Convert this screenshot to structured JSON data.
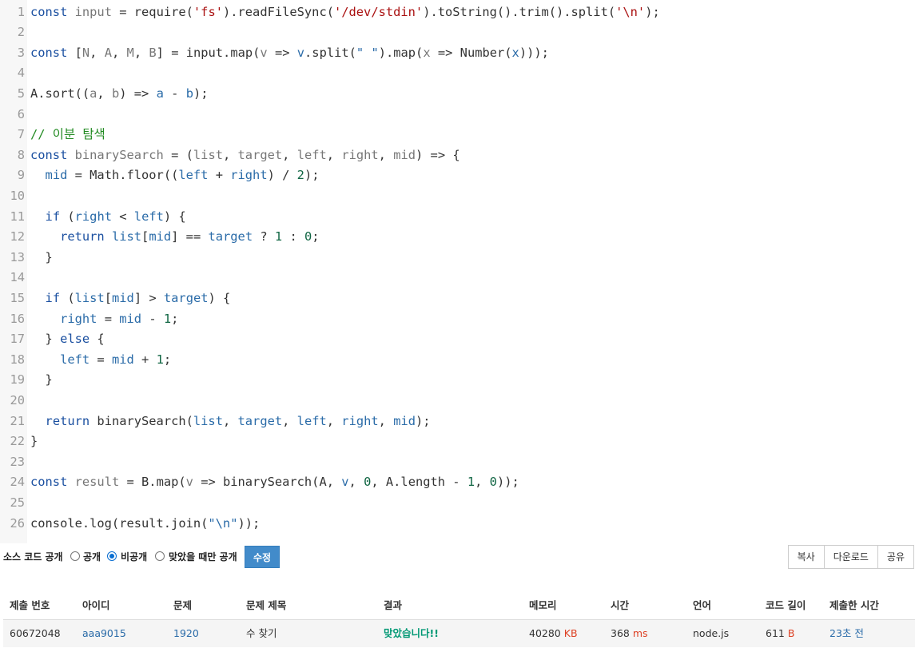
{
  "code": {
    "lines": [
      {
        "n": "1",
        "tokens": [
          [
            "kw",
            "const"
          ],
          [
            "p",
            " "
          ],
          [
            "def",
            "input"
          ],
          [
            "p",
            " = require("
          ],
          [
            "str",
            "'fs'"
          ],
          [
            "p",
            ").readFileSync("
          ],
          [
            "str",
            "'/dev/stdin'"
          ],
          [
            "p",
            ").toString().trim().split("
          ],
          [
            "str",
            "'\\n'"
          ],
          [
            "p",
            ");"
          ]
        ]
      },
      {
        "n": "2",
        "tokens": []
      },
      {
        "n": "3",
        "tokens": [
          [
            "kw",
            "const"
          ],
          [
            "p",
            " ["
          ],
          [
            "def",
            "N"
          ],
          [
            "p",
            ", "
          ],
          [
            "def",
            "A"
          ],
          [
            "p",
            ", "
          ],
          [
            "def",
            "M"
          ],
          [
            "p",
            ", "
          ],
          [
            "def",
            "B"
          ],
          [
            "p",
            "] = input.map("
          ],
          [
            "def",
            "v"
          ],
          [
            "p",
            " => "
          ],
          [
            "var",
            "v"
          ],
          [
            "p",
            ".split("
          ],
          [
            "str2",
            "\" \""
          ],
          [
            "p",
            ").map("
          ],
          [
            "def",
            "x"
          ],
          [
            "p",
            " => Number("
          ],
          [
            "var",
            "x"
          ],
          [
            "p",
            ")));"
          ]
        ]
      },
      {
        "n": "4",
        "tokens": []
      },
      {
        "n": "5",
        "tokens": [
          [
            "p",
            "A.sort(("
          ],
          [
            "def",
            "a"
          ],
          [
            "p",
            ", "
          ],
          [
            "def",
            "b"
          ],
          [
            "p",
            ") => "
          ],
          [
            "var",
            "a"
          ],
          [
            "p",
            " - "
          ],
          [
            "var",
            "b"
          ],
          [
            "p",
            ");"
          ]
        ]
      },
      {
        "n": "6",
        "tokens": []
      },
      {
        "n": "7",
        "tokens": [
          [
            "com",
            "// 이분 탐색"
          ]
        ]
      },
      {
        "n": "8",
        "tokens": [
          [
            "kw",
            "const"
          ],
          [
            "p",
            " "
          ],
          [
            "def",
            "binarySearch"
          ],
          [
            "p",
            " = ("
          ],
          [
            "def",
            "list"
          ],
          [
            "p",
            ", "
          ],
          [
            "def",
            "target"
          ],
          [
            "p",
            ", "
          ],
          [
            "def",
            "left"
          ],
          [
            "p",
            ", "
          ],
          [
            "def",
            "right"
          ],
          [
            "p",
            ", "
          ],
          [
            "def",
            "mid"
          ],
          [
            "p",
            ") => {"
          ]
        ]
      },
      {
        "n": "9",
        "tokens": [
          [
            "p",
            "  "
          ],
          [
            "var",
            "mid"
          ],
          [
            "p",
            " = Math.floor(("
          ],
          [
            "var",
            "left"
          ],
          [
            "p",
            " + "
          ],
          [
            "var",
            "right"
          ],
          [
            "p",
            ") / "
          ],
          [
            "num",
            "2"
          ],
          [
            "p",
            ");"
          ]
        ]
      },
      {
        "n": "10",
        "tokens": []
      },
      {
        "n": "11",
        "tokens": [
          [
            "p",
            "  "
          ],
          [
            "kw",
            "if"
          ],
          [
            "p",
            " ("
          ],
          [
            "var",
            "right"
          ],
          [
            "p",
            " < "
          ],
          [
            "var",
            "left"
          ],
          [
            "p",
            ") {"
          ]
        ]
      },
      {
        "n": "12",
        "tokens": [
          [
            "p",
            "    "
          ],
          [
            "kw",
            "return"
          ],
          [
            "p",
            " "
          ],
          [
            "var",
            "list"
          ],
          [
            "p",
            "["
          ],
          [
            "var",
            "mid"
          ],
          [
            "p",
            "] == "
          ],
          [
            "var",
            "target"
          ],
          [
            "p",
            " ? "
          ],
          [
            "num",
            "1"
          ],
          [
            "p",
            " : "
          ],
          [
            "num",
            "0"
          ],
          [
            "p",
            ";"
          ]
        ]
      },
      {
        "n": "13",
        "tokens": [
          [
            "p",
            "  }"
          ]
        ]
      },
      {
        "n": "14",
        "tokens": []
      },
      {
        "n": "15",
        "tokens": [
          [
            "p",
            "  "
          ],
          [
            "kw",
            "if"
          ],
          [
            "p",
            " ("
          ],
          [
            "var",
            "list"
          ],
          [
            "p",
            "["
          ],
          [
            "var",
            "mid"
          ],
          [
            "p",
            "] > "
          ],
          [
            "var",
            "target"
          ],
          [
            "p",
            ") {"
          ]
        ]
      },
      {
        "n": "16",
        "tokens": [
          [
            "p",
            "    "
          ],
          [
            "var",
            "right"
          ],
          [
            "p",
            " = "
          ],
          [
            "var",
            "mid"
          ],
          [
            "p",
            " - "
          ],
          [
            "num",
            "1"
          ],
          [
            "p",
            ";"
          ]
        ]
      },
      {
        "n": "17",
        "tokens": [
          [
            "p",
            "  } "
          ],
          [
            "kw",
            "else"
          ],
          [
            "p",
            " {"
          ]
        ]
      },
      {
        "n": "18",
        "tokens": [
          [
            "p",
            "    "
          ],
          [
            "var",
            "left"
          ],
          [
            "p",
            " = "
          ],
          [
            "var",
            "mid"
          ],
          [
            "p",
            " + "
          ],
          [
            "num",
            "1"
          ],
          [
            "p",
            ";"
          ]
        ]
      },
      {
        "n": "19",
        "tokens": [
          [
            "p",
            "  }"
          ]
        ]
      },
      {
        "n": "20",
        "tokens": []
      },
      {
        "n": "21",
        "tokens": [
          [
            "p",
            "  "
          ],
          [
            "kw",
            "return"
          ],
          [
            "p",
            " binarySearch("
          ],
          [
            "var",
            "list"
          ],
          [
            "p",
            ", "
          ],
          [
            "var",
            "target"
          ],
          [
            "p",
            ", "
          ],
          [
            "var",
            "left"
          ],
          [
            "p",
            ", "
          ],
          [
            "var",
            "right"
          ],
          [
            "p",
            ", "
          ],
          [
            "var",
            "mid"
          ],
          [
            "p",
            ");"
          ]
        ]
      },
      {
        "n": "22",
        "tokens": [
          [
            "p",
            "}"
          ]
        ]
      },
      {
        "n": "23",
        "tokens": []
      },
      {
        "n": "24",
        "tokens": [
          [
            "kw",
            "const"
          ],
          [
            "p",
            " "
          ],
          [
            "def",
            "result"
          ],
          [
            "p",
            " = B.map("
          ],
          [
            "def",
            "v"
          ],
          [
            "p",
            " => binarySearch(A, "
          ],
          [
            "var",
            "v"
          ],
          [
            "p",
            ", "
          ],
          [
            "num",
            "0"
          ],
          [
            "p",
            ", A.length - "
          ],
          [
            "num",
            "1"
          ],
          [
            "p",
            ", "
          ],
          [
            "num",
            "0"
          ],
          [
            "p",
            "));"
          ]
        ]
      },
      {
        "n": "25",
        "tokens": []
      },
      {
        "n": "26",
        "tokens": [
          [
            "p",
            "console.log(result.join("
          ],
          [
            "str2",
            "\"\\n\""
          ],
          [
            "p",
            "));"
          ]
        ]
      }
    ]
  },
  "controls": {
    "source_label": "소스 코드 공개",
    "options": [
      {
        "label": "공개",
        "checked": false
      },
      {
        "label": "비공개",
        "checked": true
      },
      {
        "label": "맞았을 때만 공개",
        "checked": false
      }
    ],
    "edit_label": "수정",
    "copy_label": "복사",
    "download_label": "다운로드",
    "share_label": "공유"
  },
  "table": {
    "headers": {
      "id": "제출 번호",
      "user": "아이디",
      "problem": "문제",
      "title": "문제 제목",
      "result": "결과",
      "memory": "메모리",
      "time": "시간",
      "lang": "언어",
      "length": "코드 길이",
      "submitted": "제출한 시간"
    },
    "row": {
      "id": "60672048",
      "user": "aaa9015",
      "problem": "1920",
      "title": "수 찾기",
      "result": "맞았습니다!!",
      "memory": "40280",
      "memory_unit": "KB",
      "time": "368",
      "time_unit": "ms",
      "lang": "node.js",
      "length": "611",
      "length_unit": "B",
      "submitted": "23초 전"
    }
  },
  "colors": {
    "accent": "#428bca",
    "success": "#009874",
    "unit": "#dd4124",
    "link": "#2a6ba8"
  }
}
